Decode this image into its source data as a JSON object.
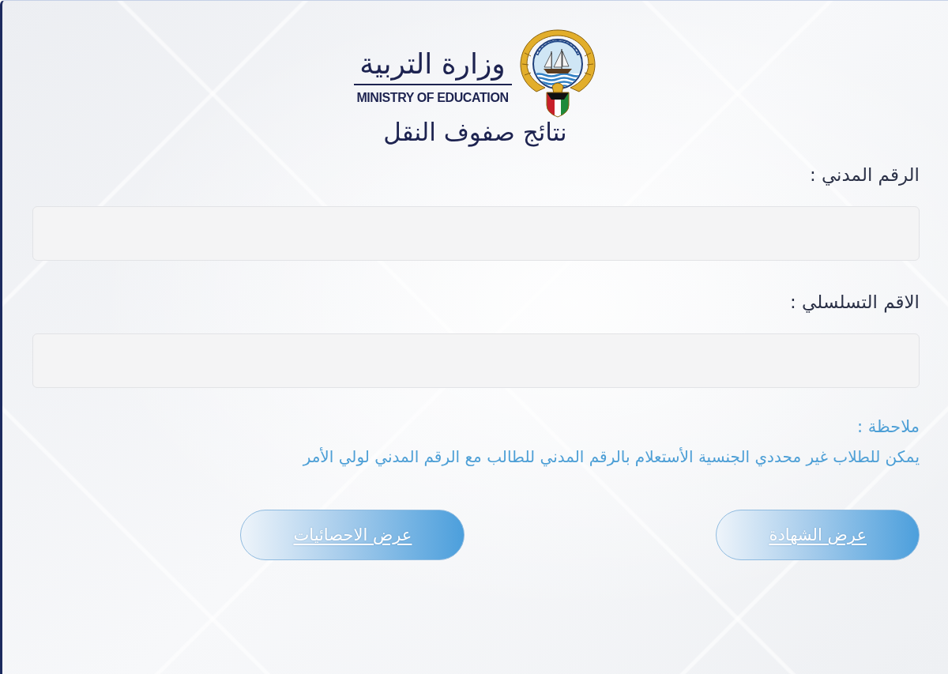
{
  "header": {
    "logo_arabic": "وزارة التربية",
    "logo_english": "MINISTRY OF EDUCATION",
    "title": "نتائج صفوف النقل"
  },
  "form": {
    "fields": [
      {
        "label": "الرقم المدني :"
      },
      {
        "label": "الاقم التسلسلي :"
      }
    ]
  },
  "note": {
    "label": "ملاحظة :",
    "text": "يمكن للطلاب غير محددي الجنسية الأستعلام بالرقم المدني للطالب مع الرقم المدني لولي الأمر"
  },
  "buttons": [
    {
      "label": "عرض الشهادة"
    },
    {
      "label": "عرض الاحصائيات"
    }
  ]
}
